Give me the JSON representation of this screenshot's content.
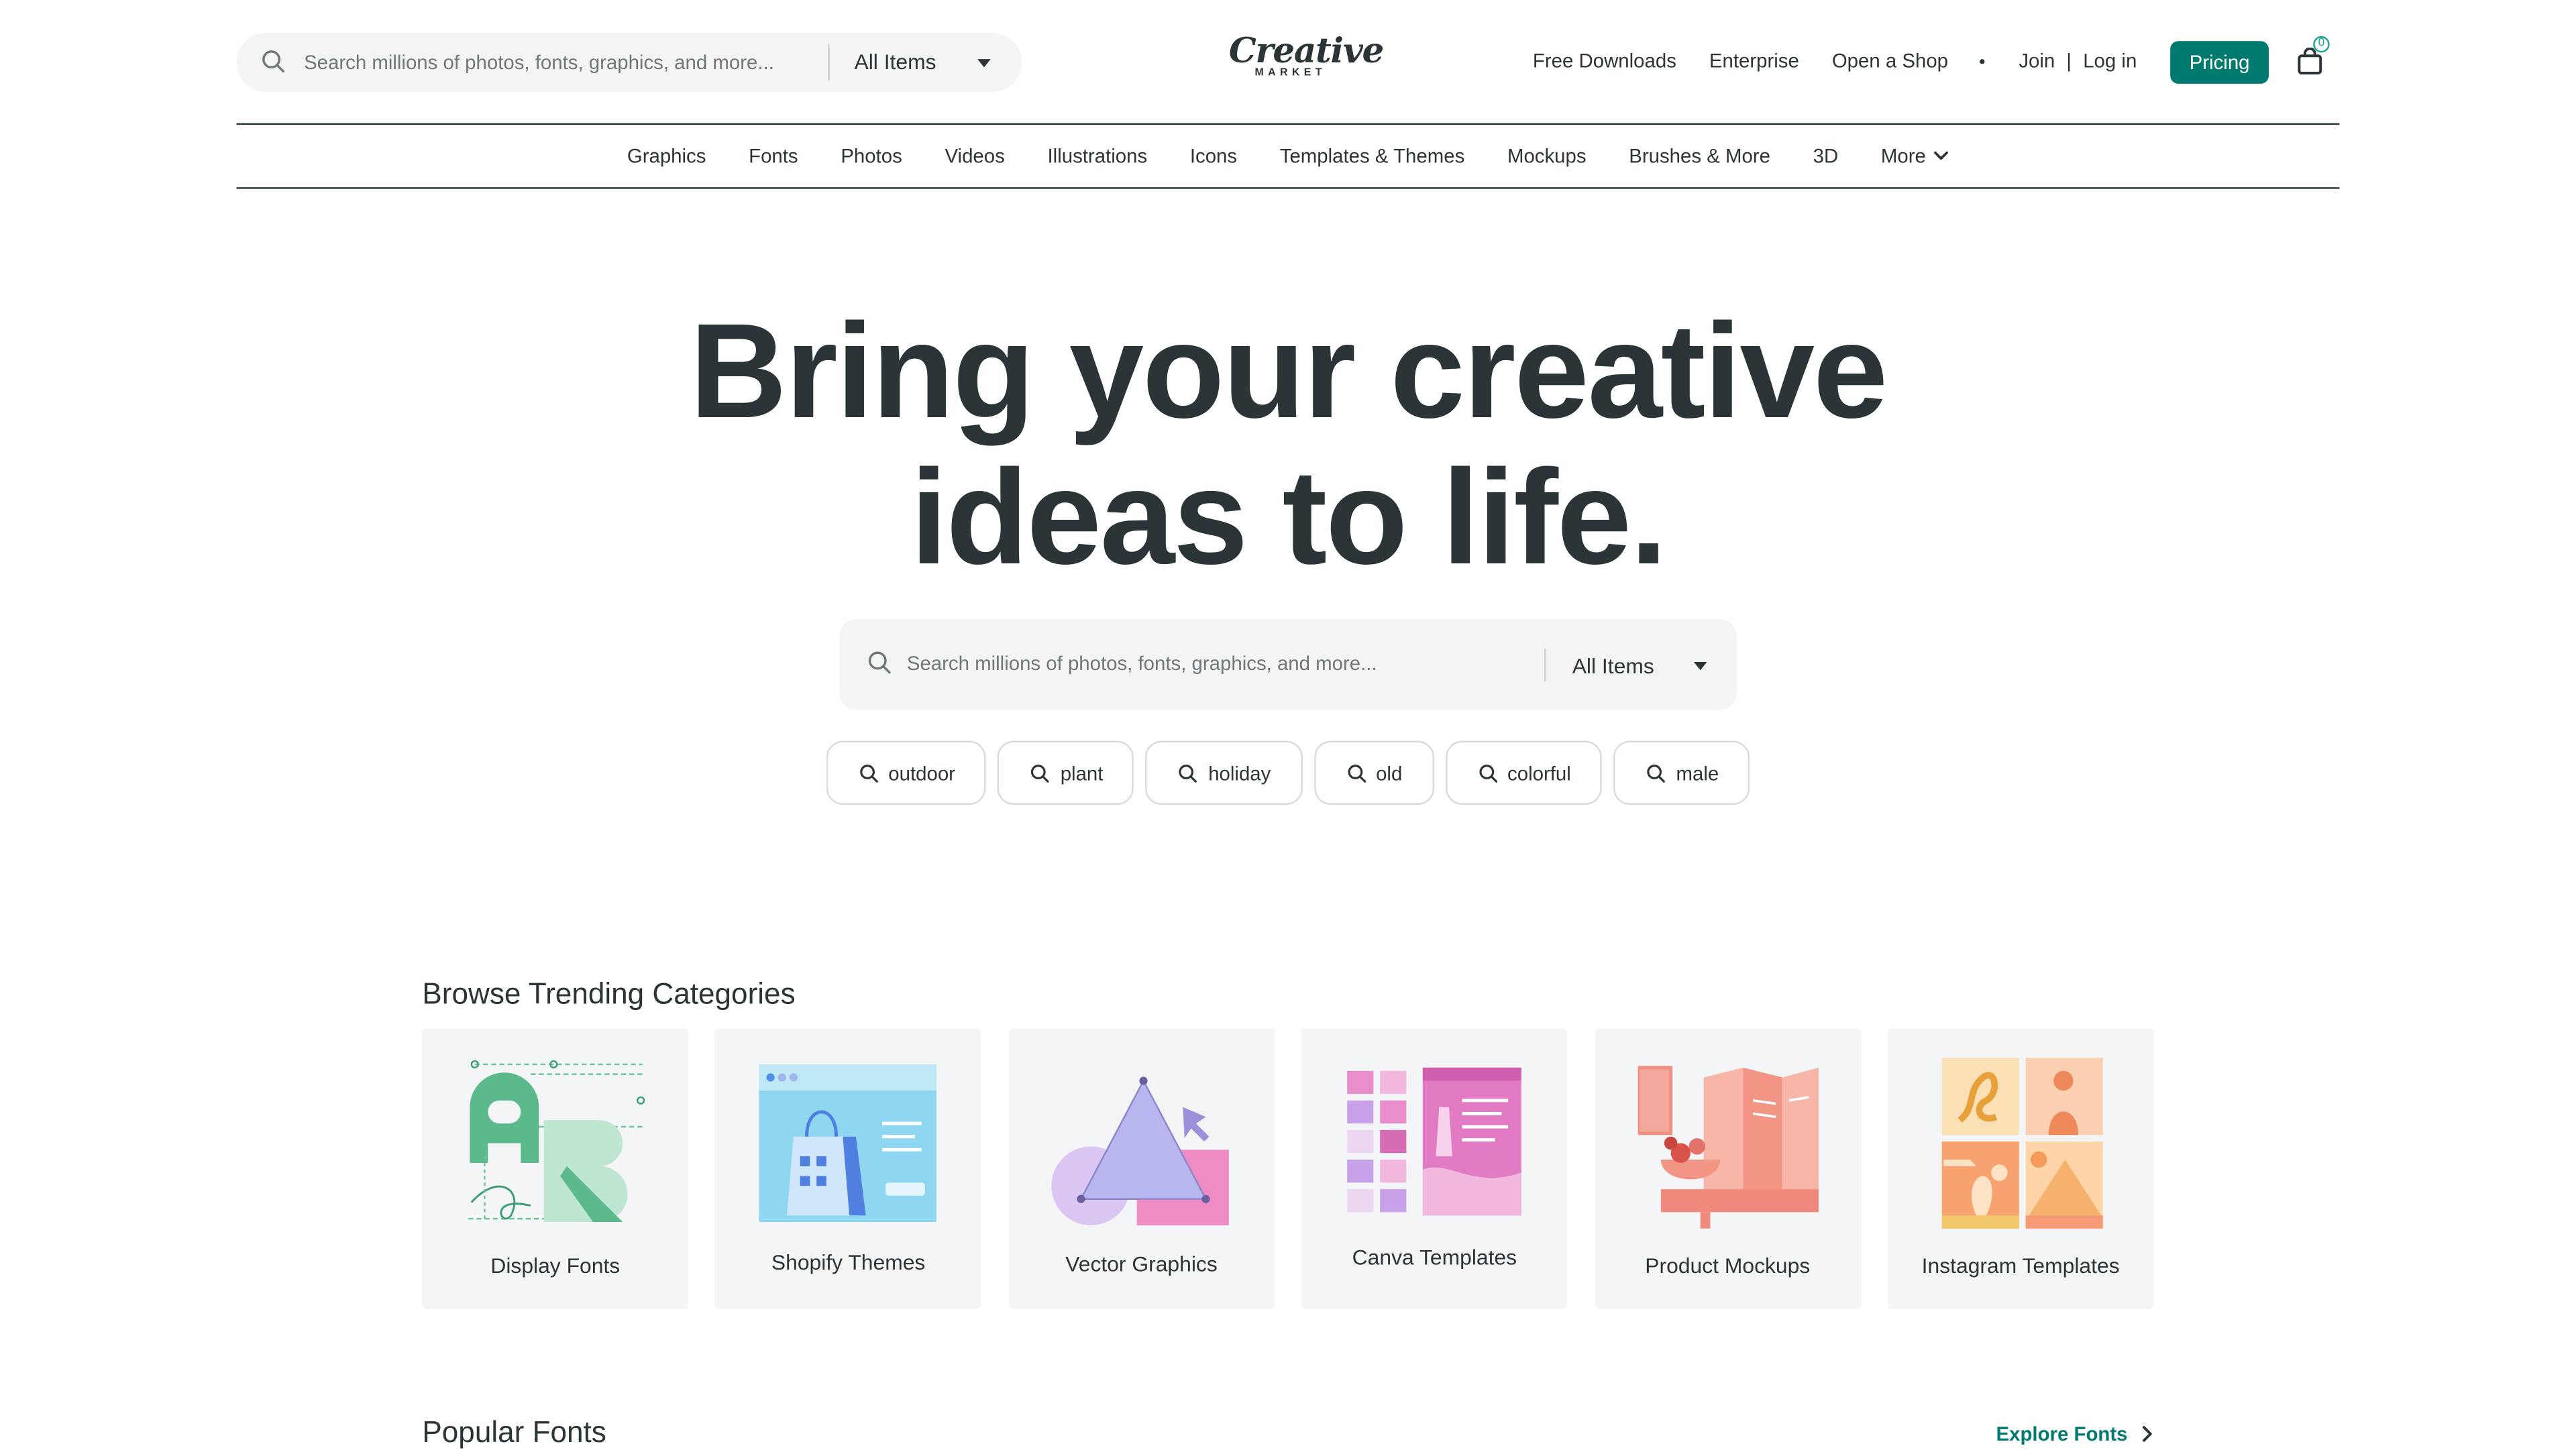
{
  "header": {
    "search_placeholder": "Search millions of photos, fonts, graphics, and more...",
    "search_scope": "All Items",
    "logo_line1": "Creative",
    "logo_line2": "MARKET",
    "links": {
      "free_downloads": "Free Downloads",
      "enterprise": "Enterprise",
      "open_shop": "Open a Shop",
      "join": "Join",
      "separator": "|",
      "login": "Log in"
    },
    "pricing_label": "Pricing",
    "cart_count": "0"
  },
  "nav": {
    "items": [
      "Graphics",
      "Fonts",
      "Photos",
      "Videos",
      "Illustrations",
      "Icons",
      "Templates & Themes",
      "Mockups",
      "Brushes & More",
      "3D"
    ],
    "more_label": "More"
  },
  "hero": {
    "title_line1": "Bring your creative",
    "title_line2": "ideas to life.",
    "search_placeholder": "Search millions of photos, fonts, graphics, and more...",
    "search_scope": "All Items",
    "chips": [
      "outdoor",
      "plant",
      "holiday",
      "old",
      "colorful",
      "male"
    ]
  },
  "trending": {
    "title": "Browse Trending Categories",
    "categories": [
      {
        "label": "Display Fonts",
        "icon": "display-fonts-illustration"
      },
      {
        "label": "Shopify Themes",
        "icon": "shopify-themes-illustration"
      },
      {
        "label": "Vector Graphics",
        "icon": "vector-graphics-illustration"
      },
      {
        "label": "Canva Templates",
        "icon": "canva-templates-illustration"
      },
      {
        "label": "Product Mockups",
        "icon": "product-mockups-illustration"
      },
      {
        "label": "Instagram Templates",
        "icon": "instagram-templates-illustration"
      }
    ]
  },
  "popular_fonts": {
    "title": "Popular Fonts",
    "explore_label": "Explore Fonts"
  },
  "colors": {
    "text": "#2b3437",
    "accent": "#007a6e",
    "search_bg": "#f3f4f5",
    "card_bg": "#f3f5f7"
  }
}
